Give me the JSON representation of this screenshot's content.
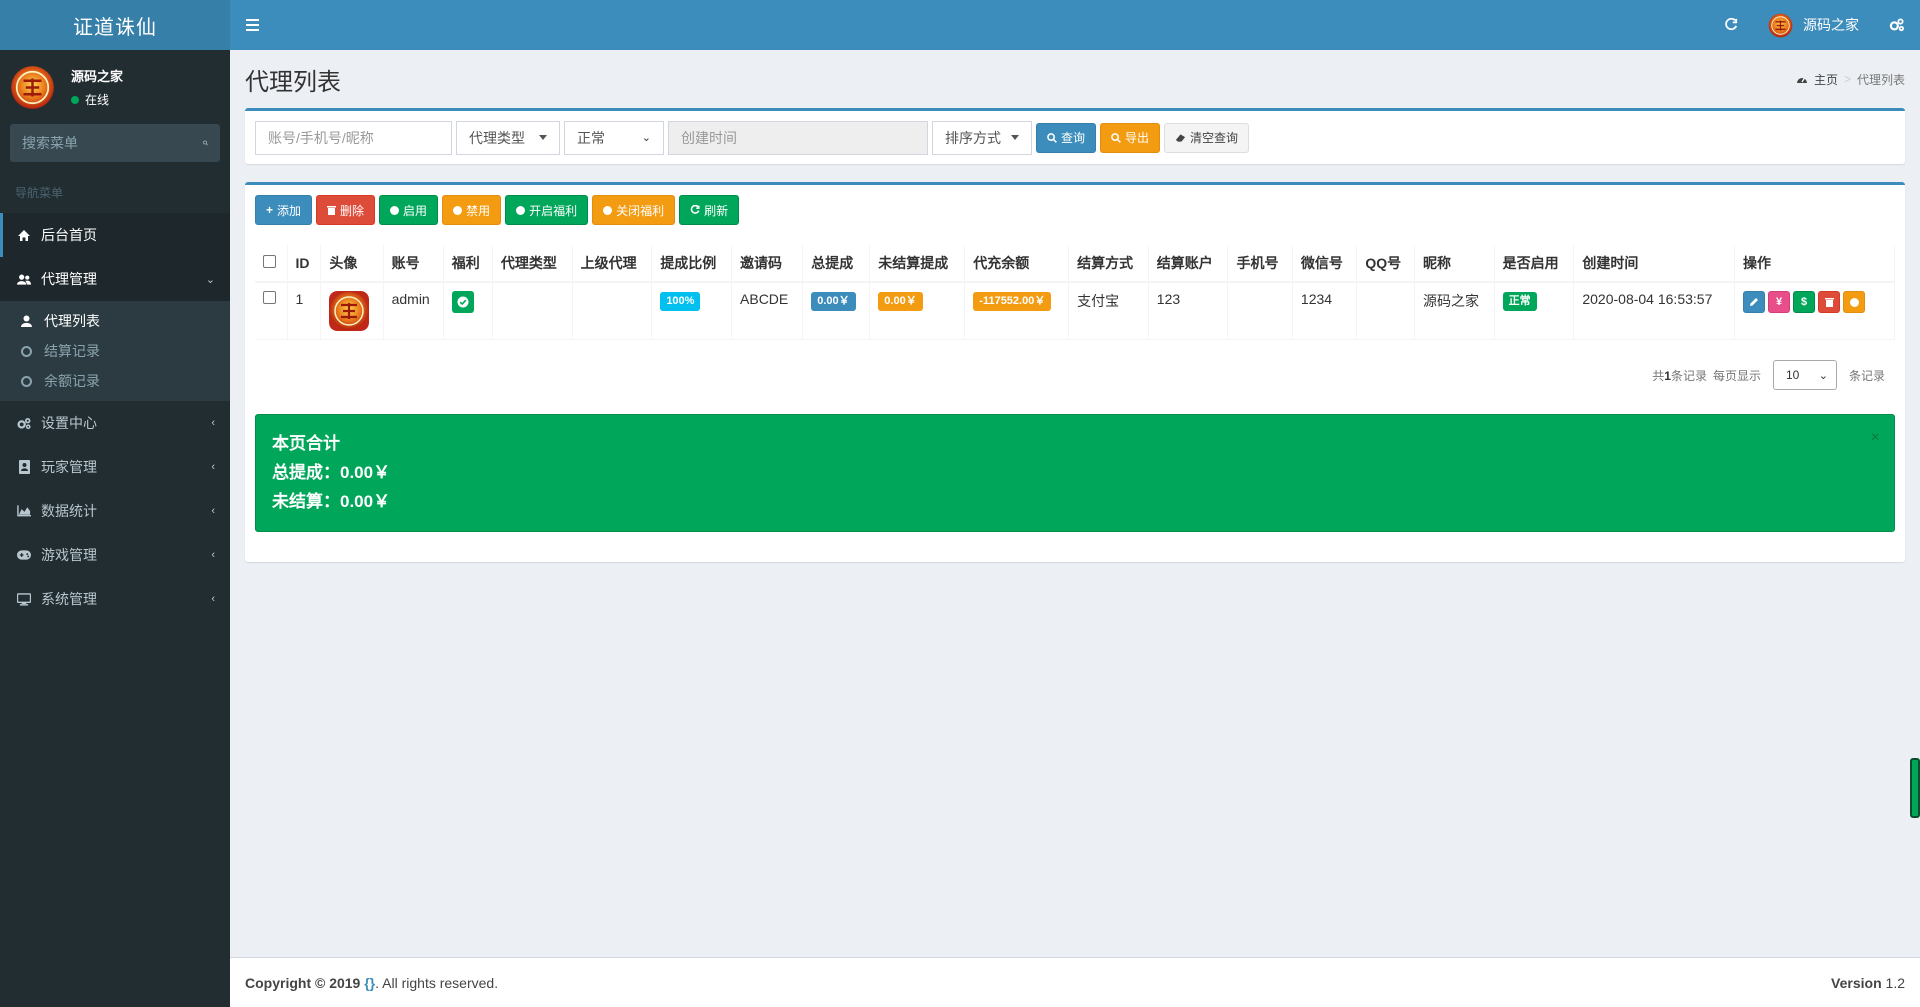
{
  "app": {
    "title": "证道诛仙"
  },
  "header": {
    "user_name": "源码之家"
  },
  "sidebar": {
    "user_name": "源码之家",
    "status": "在线",
    "search_placeholder": "搜索菜单",
    "nav_header": "导航菜单",
    "items": [
      {
        "label": "后台首页",
        "icon": "home-icon"
      },
      {
        "label": "代理管理",
        "icon": "users-icon"
      },
      {
        "label": "设置中心",
        "icon": "cogs-icon"
      },
      {
        "label": "玩家管理",
        "icon": "address-book-icon"
      },
      {
        "label": "数据统计",
        "icon": "area-chart-icon"
      },
      {
        "label": "游戏管理",
        "icon": "gamepad-icon"
      },
      {
        "label": "系统管理",
        "icon": "desktop-icon"
      }
    ],
    "subitems": [
      {
        "label": "代理列表"
      },
      {
        "label": "结算记录"
      },
      {
        "label": "余额记录"
      }
    ]
  },
  "page": {
    "title": "代理列表",
    "breadcrumb_home": "主页",
    "breadcrumb_current": "代理列表"
  },
  "filter": {
    "account_placeholder": "账号/手机号/昵称",
    "agent_type": "代理类型",
    "status": "正常",
    "time_placeholder": "创建时间",
    "sort": "排序方式",
    "query_label": "查询",
    "export_label": "导出",
    "clear_label": "清空查询"
  },
  "toolbar": {
    "add_label": "添加",
    "delete_label": "删除",
    "enable_label": "启用",
    "disable_label": "禁用",
    "open_welfare_label": "开启福利",
    "close_welfare_label": "关闭福利",
    "refresh_label": "刷新"
  },
  "table": {
    "headers": [
      "ID",
      "头像",
      "账号",
      "福利",
      "代理类型",
      "上级代理",
      "提成比例",
      "邀请码",
      "总提成",
      "未结算提成",
      "代充余额",
      "结算方式",
      "结算账户",
      "手机号",
      "微信号",
      "QQ号",
      "昵称",
      "是否启用",
      "创建时间",
      "操作"
    ],
    "rows": [
      {
        "id": "1",
        "account": "admin",
        "agent_type": "",
        "parent": "",
        "ratio": "100%",
        "invite": "ABCDE",
        "total": "0.00￥",
        "unsettled": "0.00￥",
        "balance": "-117552.00￥",
        "settle_method": "支付宝",
        "settle_account": "123",
        "phone": "",
        "wechat": "1234",
        "qq": "",
        "nickname": "源码之家",
        "enabled": "正常",
        "created": "2020-08-04 16:53:57"
      }
    ]
  },
  "pager": {
    "total_prefix": "共",
    "total_count": "1",
    "total_suffix": "条记录",
    "per_page_label": "每页显示",
    "page_size": "10",
    "records_label": "条记录"
  },
  "summary": {
    "title": "本页合计",
    "total_label": "总提成：0.00￥",
    "unsettled_label": "未结算：0.00￥"
  },
  "footer": {
    "copyright_prefix": "Copyright © 2019 ",
    "brace": "{}",
    "suffix": ". All rights reserved.",
    "version_label": "Version",
    "version": "1.2"
  },
  "colors": {
    "header": "#3c8dbc",
    "logo": "#367fa9",
    "sidebar": "#222d32",
    "success": "#00a65a",
    "warning": "#f39c12",
    "danger": "#dd4b39",
    "info": "#00c0ef"
  }
}
